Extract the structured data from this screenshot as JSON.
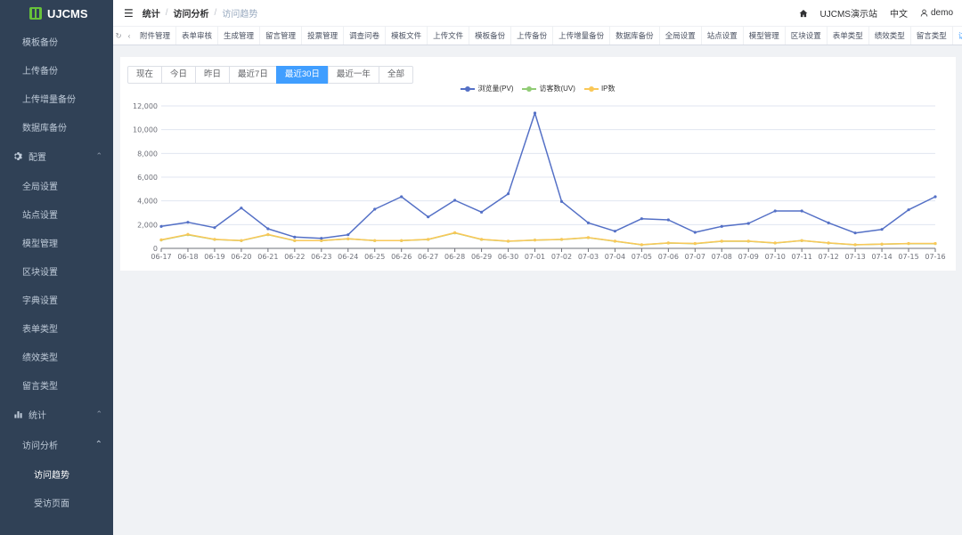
{
  "app": {
    "logo_text": "UJCMS"
  },
  "sidebar": {
    "items_top": [
      "模板备份",
      "上传备份",
      "上传增量备份",
      "数据库备份"
    ],
    "config_group": {
      "label": "配置",
      "icon": "gear-icon"
    },
    "config_items": [
      "全局设置",
      "站点设置",
      "模型管理",
      "区块设置",
      "字典设置",
      "表单类型",
      "绩效类型",
      "留言类型"
    ],
    "stats_group": {
      "label": "统计",
      "icon": "bar-chart-icon"
    },
    "stats_sub": "访问分析",
    "stats_items": [
      "访问趋势",
      "受访页面"
    ]
  },
  "header": {
    "breadcrumb": [
      "统计",
      "访问分析",
      "访问趋势"
    ],
    "site_name": "UJCMS演示站",
    "language": "中文",
    "user": "demo"
  },
  "tabs": [
    "附件管理",
    "表单审核",
    "生成管理",
    "留言管理",
    "投票管理",
    "调查问卷",
    "模板文件",
    "上传文件",
    "模板备份",
    "上传备份",
    "上传增量备份",
    "数据库备份",
    "全局设置",
    "站点设置",
    "模型管理",
    "区块设置",
    "表单类型",
    "绩效类型",
    "留言类型",
    "访问趋势 ×"
  ],
  "range_buttons": [
    "现在",
    "今日",
    "昨日",
    "最近7日",
    "最近30日",
    "最近一年",
    "全部"
  ],
  "range_selected": "最近30日",
  "colors": {
    "accent": "#409eff",
    "sidebar_bg": "#304156",
    "pv": "#5470c6",
    "uv": "#91cc75",
    "ip": "#fac858"
  },
  "chart_data": {
    "type": "line",
    "categories": [
      "06-17",
      "06-18",
      "06-19",
      "06-20",
      "06-21",
      "06-22",
      "06-23",
      "06-24",
      "06-25",
      "06-26",
      "06-27",
      "06-28",
      "06-29",
      "06-30",
      "07-01",
      "07-02",
      "07-03",
      "07-04",
      "07-05",
      "07-06",
      "07-07",
      "07-08",
      "07-09",
      "07-10",
      "07-11",
      "07-12",
      "07-13",
      "07-14",
      "07-15",
      "07-16"
    ],
    "yticks": [
      "0",
      "2,000",
      "4,000",
      "6,000",
      "8,000",
      "10,000",
      "12,000"
    ],
    "ylim": [
      0,
      12000
    ],
    "legend_position": "top-center",
    "grid": true,
    "series": [
      {
        "name": "浏览量(PV)",
        "color": "#5470c6",
        "values": [
          1850,
          2200,
          1750,
          3400,
          1650,
          950,
          850,
          1150,
          3300,
          4350,
          2650,
          4050,
          3050,
          4600,
          11400,
          3950,
          2150,
          1450,
          2500,
          2400,
          1350,
          1850,
          2100,
          3150,
          3150,
          2150,
          1300,
          1600,
          3250,
          4350
        ]
      },
      {
        "name": "访客数(UV)",
        "color": "#91cc75",
        "values": [
          700,
          1150,
          750,
          650,
          1150,
          650,
          650,
          800,
          650,
          650,
          750,
          1300,
          750,
          600,
          700,
          750,
          900,
          600,
          300,
          450,
          400,
          600,
          600,
          450,
          650,
          450,
          300,
          350,
          400,
          400
        ]
      },
      {
        "name": "IP数",
        "color": "#fac858",
        "values": [
          720,
          1180,
          760,
          660,
          1170,
          660,
          660,
          800,
          660,
          660,
          760,
          1320,
          760,
          610,
          700,
          760,
          910,
          610,
          310,
          460,
          410,
          610,
          610,
          460,
          660,
          460,
          310,
          360,
          410,
          410
        ]
      }
    ]
  }
}
